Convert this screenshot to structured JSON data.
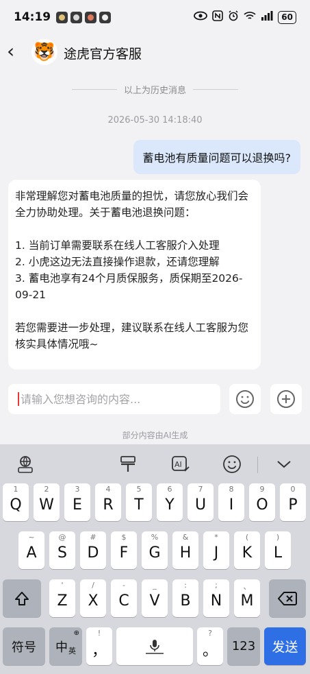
{
  "status_bar": {
    "time": "14:19",
    "battery": "60",
    "notification_icons": [
      "app-icon-1",
      "app-icon-2",
      "app-icon-3",
      "app-icon-4"
    ],
    "system_icons": [
      "eye-icon",
      "nfc-icon",
      "alarm-icon",
      "wifi-icon",
      "signal-icon"
    ]
  },
  "header": {
    "back_glyph": "‹",
    "avatar_glyph": "🐯",
    "title": "途虎官方客服"
  },
  "chat": {
    "history_divider": "以上为历史消息",
    "timestamp": "2026-05-30 14:18:40",
    "user_message": "蓄电池有质量问题可以退换吗?",
    "bot_message": {
      "intro": "非常理解您对蓄电池质量的担忧，请您放心我们会全力协助处理。关于蓄电池退换问题：",
      "items": [
        "1. 当前订单需要联系在线人工客服介入处理",
        "2. 小虎这边无法直接操作退款，还请您理解",
        "3. 蓄电池享有24个月质保服务，质保期至2026-09-21"
      ],
      "outro": "若您需要进一步处理，建议联系在线人工客服为您核实具体情况哦~"
    }
  },
  "input": {
    "placeholder": "请输入您想咨询的内容..."
  },
  "ai_note": "部分内容由AI生成",
  "keyboard": {
    "row1": [
      {
        "main": "Q",
        "hint": "1"
      },
      {
        "main": "W",
        "hint": "2"
      },
      {
        "main": "E",
        "hint": "3"
      },
      {
        "main": "R",
        "hint": "4"
      },
      {
        "main": "T",
        "hint": "5"
      },
      {
        "main": "Y",
        "hint": "6"
      },
      {
        "main": "U",
        "hint": "7"
      },
      {
        "main": "I",
        "hint": "8"
      },
      {
        "main": "O",
        "hint": "9"
      },
      {
        "main": "P",
        "hint": "0"
      }
    ],
    "row2": [
      {
        "main": "A",
        "hint": "~"
      },
      {
        "main": "S",
        "hint": "@"
      },
      {
        "main": "D",
        "hint": "#"
      },
      {
        "main": "F",
        "hint": "$"
      },
      {
        "main": "G",
        "hint": "%"
      },
      {
        "main": "H",
        "hint": "&"
      },
      {
        "main": "J",
        "hint": "*"
      },
      {
        "main": "K",
        "hint": "("
      },
      {
        "main": "L",
        "hint": ")"
      }
    ],
    "row3": [
      {
        "main": "Z",
        "hint": "'"
      },
      {
        "main": "X",
        "hint": "/"
      },
      {
        "main": "C",
        "hint": "-"
      },
      {
        "main": "V",
        "hint": "_"
      },
      {
        "main": "B",
        "hint": ":"
      },
      {
        "main": "N",
        "hint": ";"
      },
      {
        "main": "M",
        "hint": "、"
      }
    ],
    "symbols_label": "符号",
    "lang_label": "中",
    "lang_sub": "英",
    "comma_label": "，",
    "comma_hint": "!",
    "period_label": "。",
    "period_hint": "?",
    "num_label": "123",
    "send_label": "发送"
  }
}
